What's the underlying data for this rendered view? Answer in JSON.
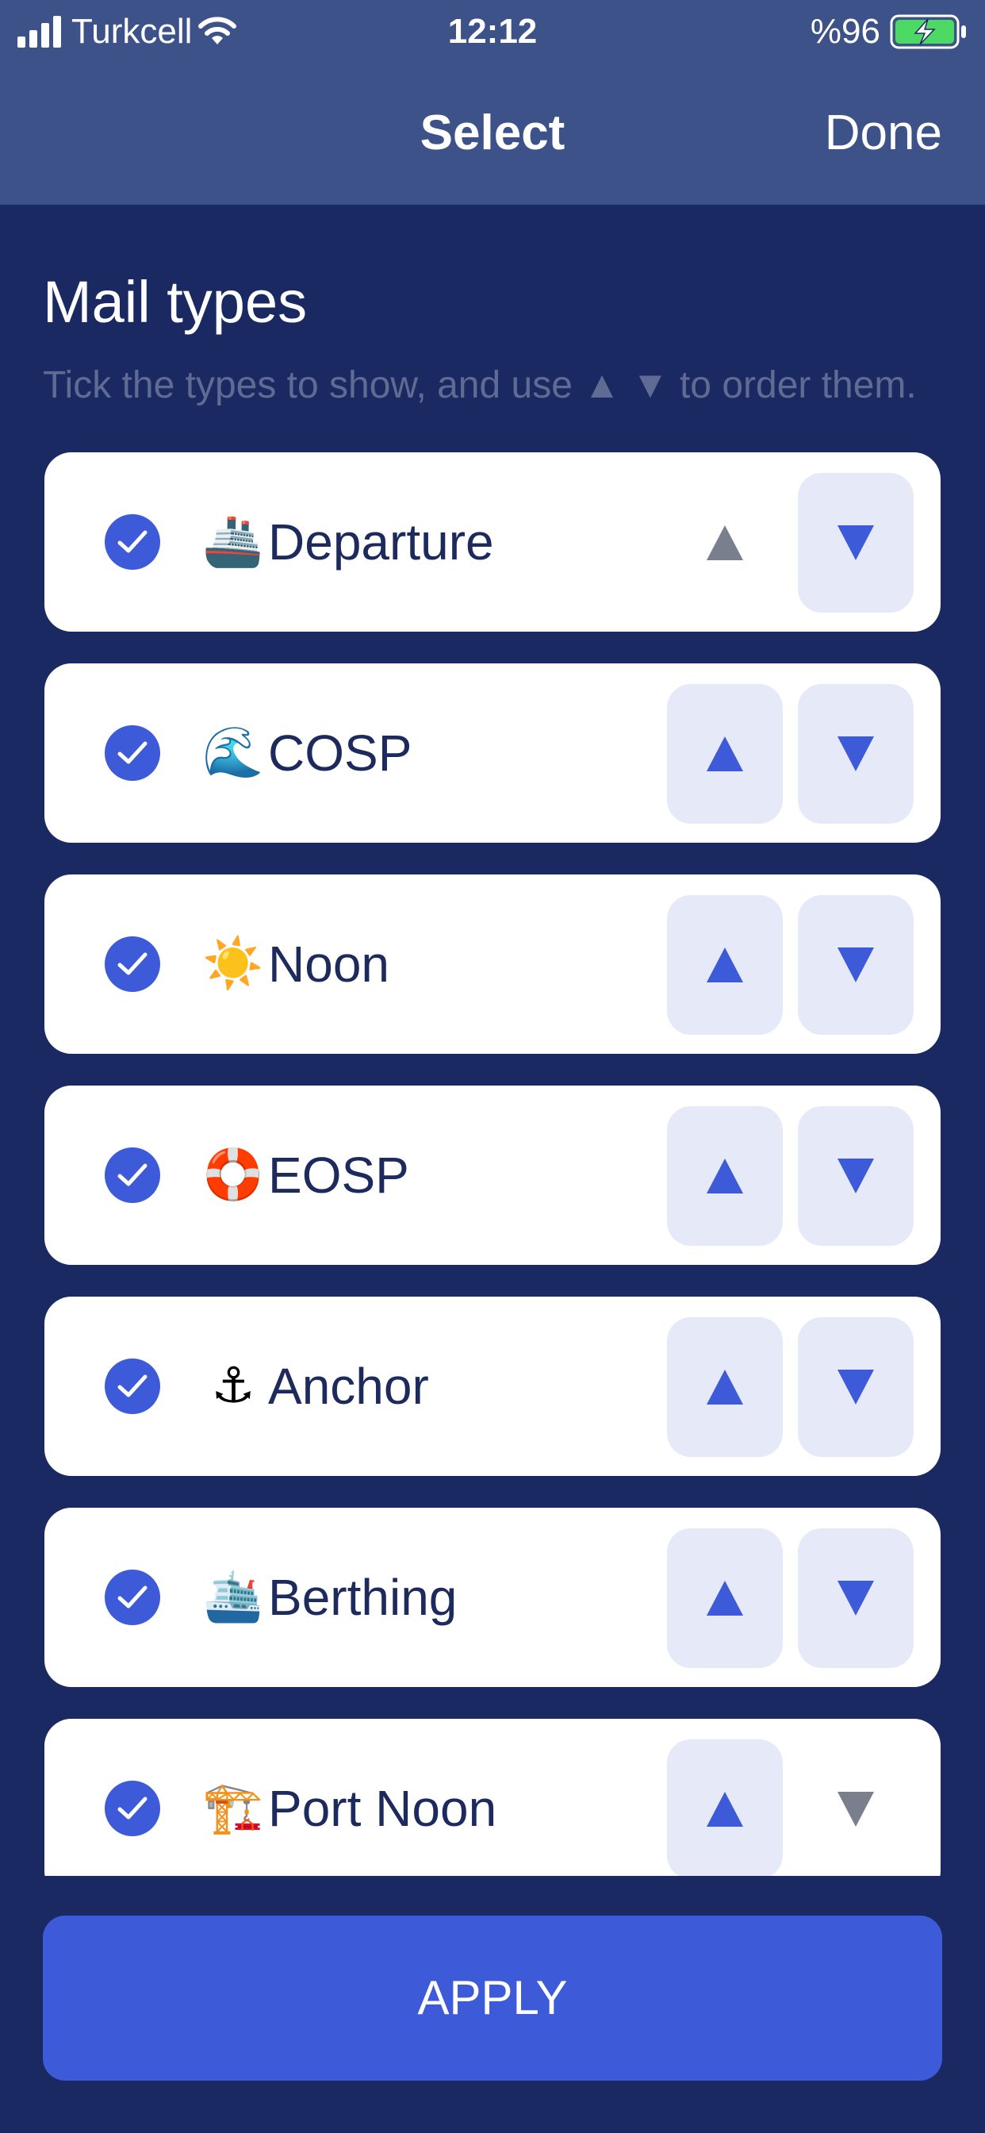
{
  "status_bar": {
    "carrier": "Turkcell",
    "time": "12:12",
    "battery": "%96"
  },
  "header": {
    "title": "Select",
    "done_label": "Done"
  },
  "section": {
    "title": "Mail types",
    "hint": "Tick the types to show, and use ▲ ▼ to order them."
  },
  "mail_types": [
    {
      "emoji": "🚢",
      "label": "Departure",
      "checked": true,
      "up_enabled": false,
      "down_enabled": true
    },
    {
      "emoji": "🌊",
      "label": "COSP",
      "checked": true,
      "up_enabled": true,
      "down_enabled": true
    },
    {
      "emoji": "☀️",
      "label": "Noon",
      "checked": true,
      "up_enabled": true,
      "down_enabled": true
    },
    {
      "emoji": "🛟",
      "label": "EOSP",
      "checked": true,
      "up_enabled": true,
      "down_enabled": true
    },
    {
      "emoji": "⚓",
      "label": "Anchor",
      "checked": true,
      "up_enabled": true,
      "down_enabled": true
    },
    {
      "emoji": "🛳️",
      "label": "Berthing",
      "checked": true,
      "up_enabled": true,
      "down_enabled": true
    },
    {
      "emoji": "🏗️",
      "label": "Port Noon",
      "checked": true,
      "up_enabled": true,
      "down_enabled": false
    }
  ],
  "footer": {
    "apply_label": "APPLY"
  },
  "colors": {
    "header_bg": "#3d5288",
    "page_bg": "#1b2962",
    "accent": "#3d5ad8",
    "button_bg": "#e6eaf8",
    "disabled_arrow": "#7a7f8e"
  }
}
